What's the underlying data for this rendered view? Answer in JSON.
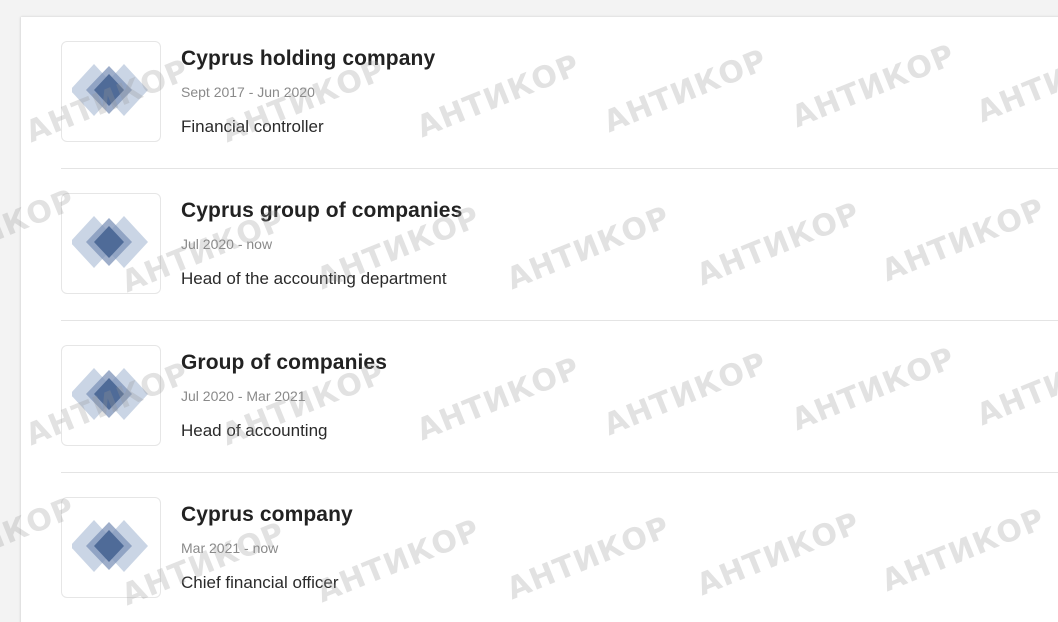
{
  "experience": [
    {
      "company": "Cyprus holding company",
      "period": "Sept 2017 - Jun 2020",
      "role": "Financial controller",
      "logo_icon": "company-diamond-logo"
    },
    {
      "company": "Cyprus group of companies",
      "period": "Jul 2020 - now",
      "role": "Head of the accounting department",
      "logo_icon": "company-diamond-logo"
    },
    {
      "company": "Group of companies",
      "period": "Jul 2020 - Mar 2021",
      "role": "Head of accounting",
      "logo_icon": "company-diamond-logo"
    },
    {
      "company": "Cyprus company",
      "period": "Mar 2021 - now",
      "role": "Chief financial officer",
      "logo_icon": "company-diamond-logo"
    }
  ],
  "watermark": {
    "text": "АНТИКОР"
  },
  "colors": {
    "logo_dark": "#4f6b98",
    "logo_light": "#9fb2cf",
    "watermark": "#969696"
  }
}
